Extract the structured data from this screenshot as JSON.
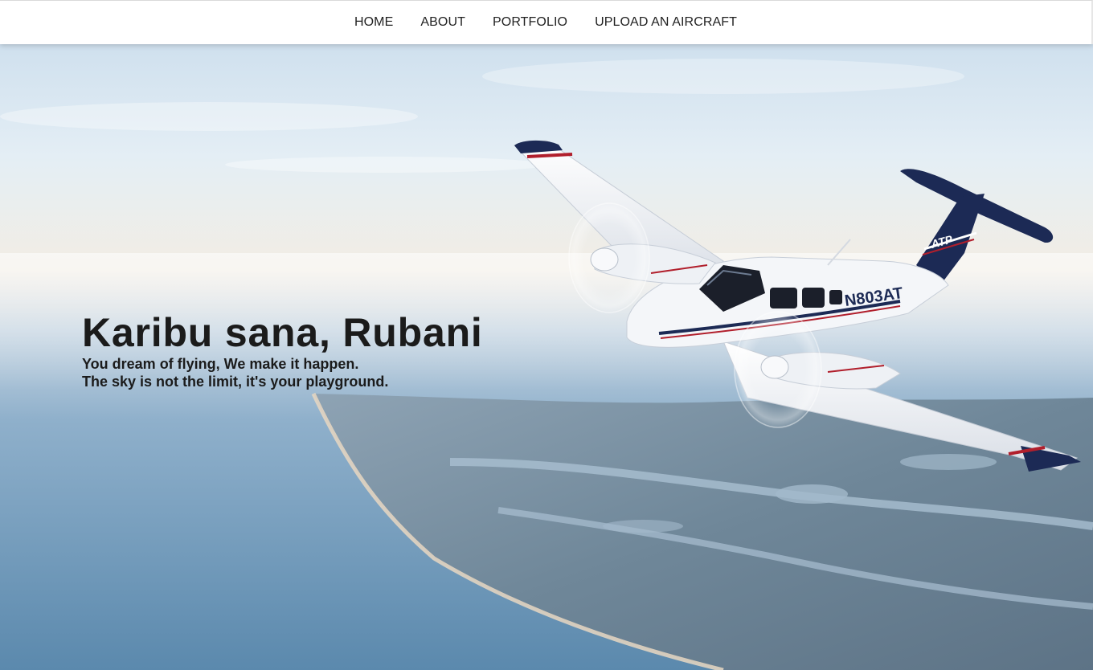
{
  "nav": {
    "items": [
      {
        "label": "HOME"
      },
      {
        "label": "ABOUT"
      },
      {
        "label": "PORTFOLIO"
      },
      {
        "label": "UPLOAD AN AIRCRAFT"
      }
    ]
  },
  "hero": {
    "title": "Karibu sana, Rubani",
    "tagline_1": "You dream of flying, We make it happen.",
    "tagline_2": "The sky is not the limit, it's your playground.",
    "aircraft_registration": "N803AT",
    "tail_logo": "ATP",
    "background_image": "aircraft-over-coastline-photo"
  },
  "colors": {
    "nav_background": "#ffffff",
    "text_dark": "#1b1b1b",
    "sky_top": "#d8e6f1",
    "sea": "#5f8fb5",
    "aircraft_body": "#f4f6f9",
    "aircraft_accent": "#1c2a55"
  }
}
